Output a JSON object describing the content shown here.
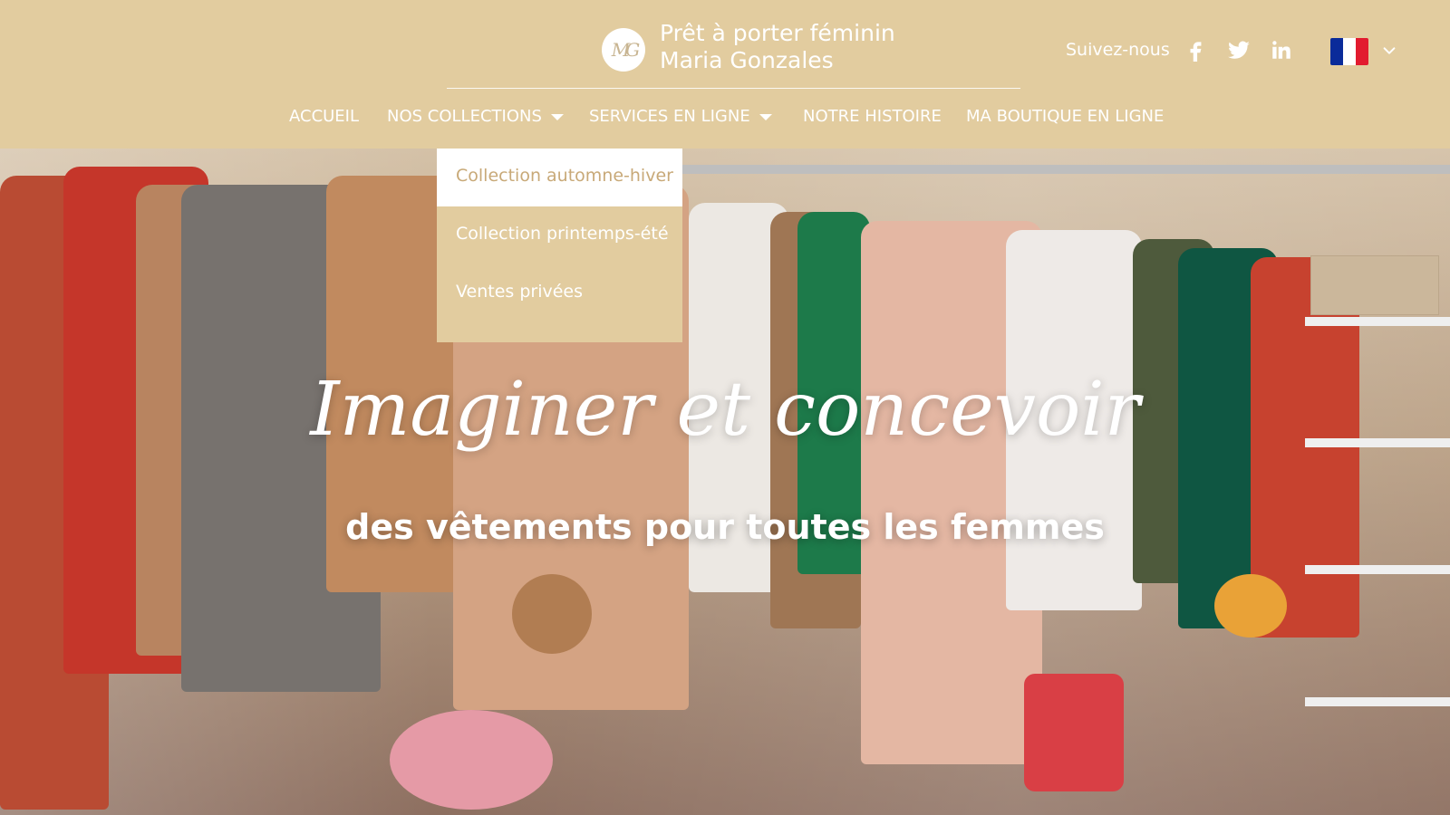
{
  "header": {
    "logo_text": "MG",
    "brand_line1": "Prêt à porter féminin",
    "brand_line2": "Maria Gonzales",
    "follow_label": "Suivez-nous",
    "social_icons": [
      "facebook-icon",
      "twitter-icon",
      "linkedin-icon"
    ],
    "language_flag": "france-flag",
    "background_color": "#e2cc9f",
    "accent_color": "#c8a978"
  },
  "nav": {
    "items": [
      {
        "label": "ACCUEIL",
        "has_caret": false
      },
      {
        "label": "NOS COLLECTIONS",
        "has_caret": true
      },
      {
        "label": "SERVICES EN LIGNE",
        "has_caret": true
      },
      {
        "label": "NOTRE HISTOIRE",
        "has_caret": false
      },
      {
        "label": "MA BOUTIQUE EN LIGNE",
        "has_caret": false
      }
    ]
  },
  "dropdown": {
    "items": [
      {
        "label": "Collection automne-hiver",
        "active": true
      },
      {
        "label": "Collection printemps-été",
        "active": false
      },
      {
        "label": "Ventes privées",
        "active": false
      }
    ]
  },
  "hero": {
    "headline": "Imaginer et concevoir",
    "subheadline": "des vêtements pour toutes les femmes"
  }
}
